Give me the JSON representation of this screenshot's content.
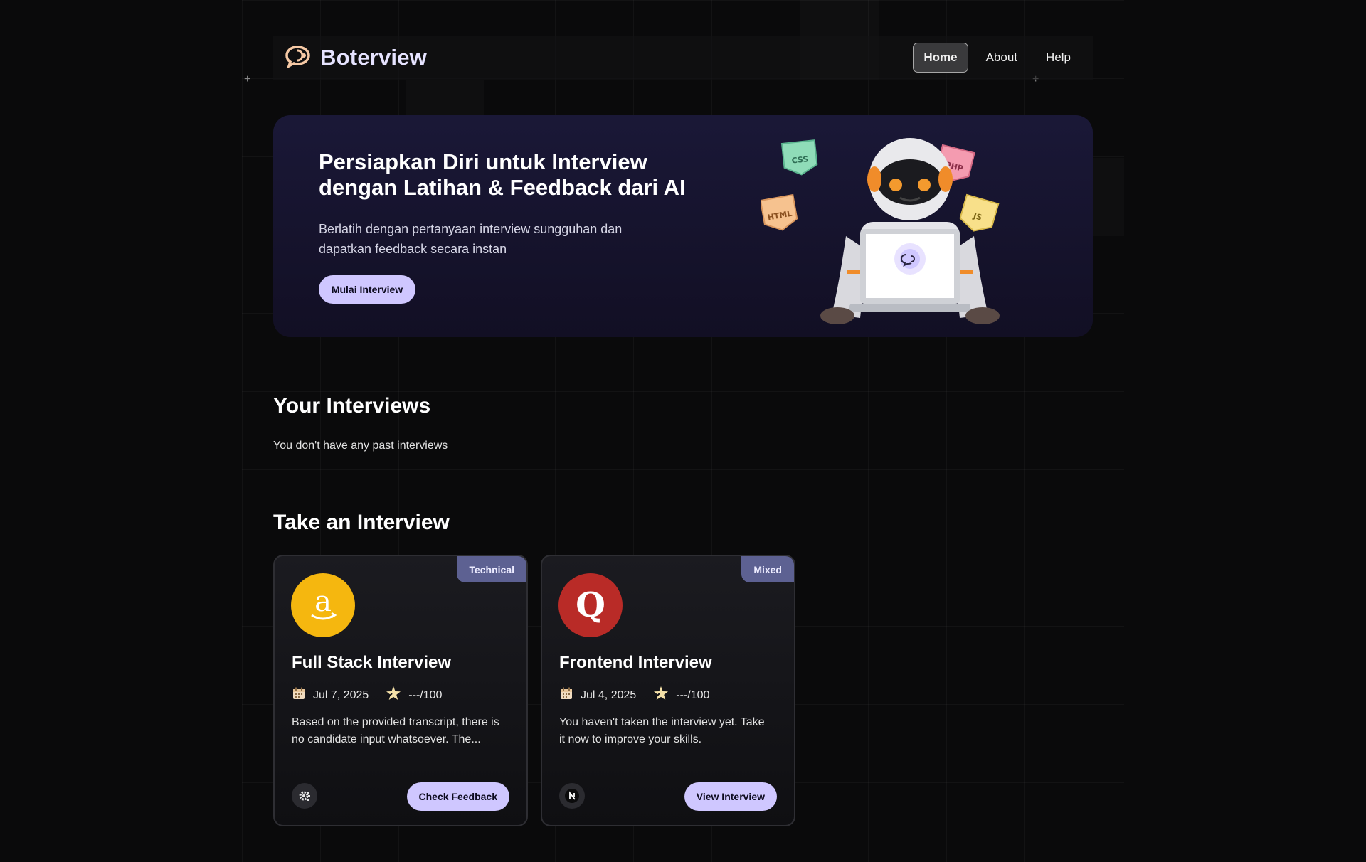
{
  "nav": {
    "brand": "Boterview",
    "links": [
      {
        "label": "Home",
        "active": true
      },
      {
        "label": "About",
        "active": false
      },
      {
        "label": "Help",
        "active": false
      }
    ]
  },
  "hero": {
    "title_line1": "Persiapkan Diri untuk Interview",
    "title_line2": "dengan Latihan & Feedback dari AI",
    "subtitle_line1": "Berlatih dengan pertanyaan interview sungguhan dan",
    "subtitle_line2": "dapatkan feedback secara instan",
    "cta_label": "Mulai Interview",
    "tags": [
      "CSS",
      "PHP",
      "HTML",
      "JS"
    ]
  },
  "your_interviews": {
    "title": "Your Interviews",
    "empty_text": "You don't have any past interviews"
  },
  "take_interview": {
    "title": "Take an Interview",
    "cards": [
      {
        "badge": "Technical",
        "logo": "amazon-logo",
        "logo_glyph": "a",
        "logo_color": "#f5b70f",
        "title": "Full Stack Interview",
        "date": "Jul 7, 2025",
        "score": "---/100",
        "desc_line1": "Based on the provided transcript, there is",
        "desc_line2": "no candidate input whatsoever. The...",
        "tech_icon": "settings-gear-icon",
        "button_label": "Check Feedback"
      },
      {
        "badge": "Mixed",
        "logo": "quora-logo",
        "logo_glyph": "Q",
        "logo_color": "#b92b27",
        "title": "Frontend Interview",
        "date": "Jul 4, 2025",
        "score": "---/100",
        "desc_line1": "You haven't taken the interview yet. Take",
        "desc_line2": "it now to improve your skills.",
        "tech_icon": "nextjs-icon",
        "button_label": "View Interview"
      }
    ]
  },
  "colors": {
    "accent": "#cfc7ff",
    "badge": "#5d6192",
    "background": "#0a0a0b",
    "hero_bg": "#1a1837"
  }
}
